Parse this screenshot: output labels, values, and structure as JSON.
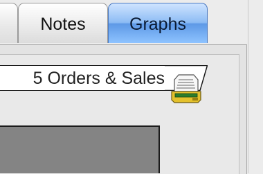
{
  "tabs": [
    {
      "label": ""
    },
    {
      "label": "Notes"
    },
    {
      "label": "Graphs"
    }
  ],
  "panel": {
    "title": "5 Orders & Sales"
  },
  "icons": {
    "print": "printer-icon"
  },
  "colors": {
    "selected_tab": "#8dbcf4",
    "tab_border_selected": "#4a78c0",
    "panel_bg": "#e9e9e9",
    "box_gray": "#848484"
  }
}
